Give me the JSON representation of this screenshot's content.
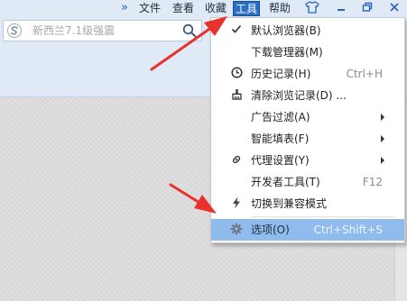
{
  "menubar": {
    "overflow_icon": "double-chevron-right-icon",
    "file": "文件",
    "view": "查看",
    "favorites": "收藏",
    "tools": "工具",
    "help": "帮助",
    "skin_icon": "tshirt-icon",
    "minimize_icon": "minimize-icon",
    "restore_icon": "restore-icon",
    "close_icon": "close-icon"
  },
  "search": {
    "engine_icon": "sogou-logo-icon",
    "placeholder": "新西兰7.1级强震",
    "search_icon": "search-icon"
  },
  "tools_menu": {
    "items": [
      {
        "icon": "checkmark-icon",
        "label": "默认浏览器(B)",
        "shortcut": "",
        "submenu": false
      },
      {
        "icon": "",
        "label": "下载管理器(M)",
        "shortcut": "",
        "submenu": false
      },
      {
        "icon": "clock-icon",
        "label": "历史记录(H)",
        "shortcut": "Ctrl+H",
        "submenu": false
      },
      {
        "icon": "broom-icon",
        "label": "清除浏览记录(D) ...",
        "shortcut": "",
        "submenu": false
      },
      {
        "icon": "",
        "label": "广告过滤(A)",
        "shortcut": "",
        "submenu": true
      },
      {
        "icon": "",
        "label": "智能填表(F)",
        "shortcut": "",
        "submenu": true
      },
      {
        "icon": "link-icon",
        "label": "代理设置(Y)",
        "shortcut": "",
        "submenu": true
      },
      {
        "icon": "",
        "label": "开发者工具(T)",
        "shortcut": "F12",
        "submenu": false
      },
      {
        "icon": "lightning-icon",
        "label": "切换到兼容模式",
        "shortcut": "",
        "submenu": false
      },
      {
        "icon": "gear-icon",
        "label": "选项(O)",
        "shortcut": "Ctrl+Shift+S",
        "submenu": false
      }
    ]
  },
  "colors": {
    "menu_highlight": "#8fbcec",
    "tools_active": "#2b6fc4",
    "annotation_arrow": "#e8322b"
  }
}
